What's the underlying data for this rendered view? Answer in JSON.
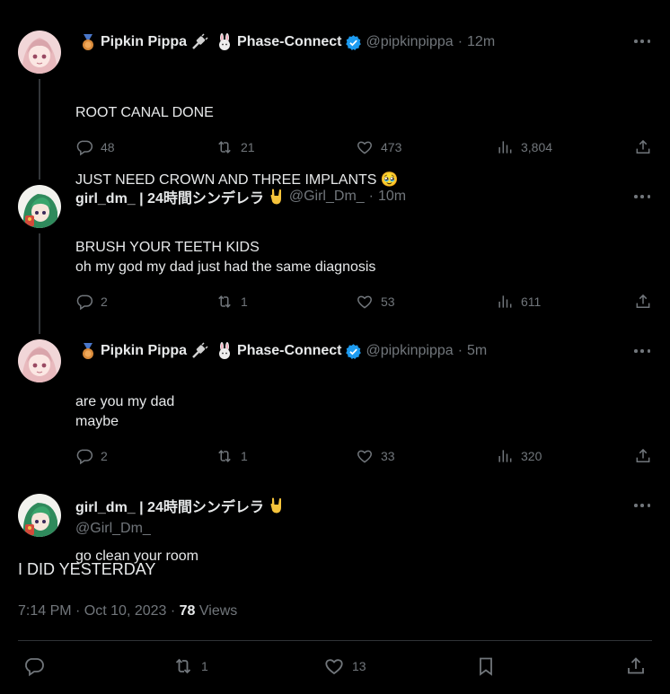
{
  "tweets": [
    {
      "name": "Pipkin Pippa",
      "affiliation": "Phase-Connect",
      "handle": "@pipkinpippa",
      "time": "12m",
      "lines": [
        "ROOT CANAL DONE",
        "JUST NEED CROWN AND THREE IMPLANTS 🥹",
        "BRUSH YOUR TEETH KIDS"
      ],
      "replies": "48",
      "retweets": "21",
      "likes": "473",
      "views": "3,804"
    },
    {
      "name": "girl_dm_ | 24時間シンデレラ",
      "handle": "@Girl_Dm_",
      "time": "10m",
      "lines": [
        "oh my god my dad just had the same diagnosis",
        "",
        "are you my dad"
      ],
      "replies": "2",
      "retweets": "1",
      "likes": "53",
      "views": "611"
    },
    {
      "name": "Pipkin Pippa",
      "affiliation": "Phase-Connect",
      "handle": "@pipkinpippa",
      "time": "5m",
      "lines": [
        "maybe",
        "",
        "go clean your room"
      ],
      "replies": "2",
      "retweets": "1",
      "likes": "33",
      "views": "320"
    }
  ],
  "main": {
    "name": "girl_dm_ | 24時間シンデレラ",
    "handle": "@Girl_Dm_",
    "text": "I DID YESTERDAY",
    "timestamp": "7:14 PM · Oct 10, 2023 · ",
    "views_count": "78",
    "views_label": " Views",
    "retweets": "1",
    "likes": "13"
  },
  "sep": "·",
  "colors": {
    "background": "#000000",
    "text": "#e7e9ea",
    "muted": "#71767b",
    "verified": "#1d9bf0",
    "divider": "#2f3336"
  },
  "icons": [
    "more-icon",
    "reply-icon",
    "retweet-icon",
    "like-icon",
    "views-icon",
    "share-icon",
    "bookmark-icon",
    "verified-badge-icon",
    "medal-icon",
    "plug-icon",
    "rabbit-icon",
    "rock-hand-icon"
  ]
}
